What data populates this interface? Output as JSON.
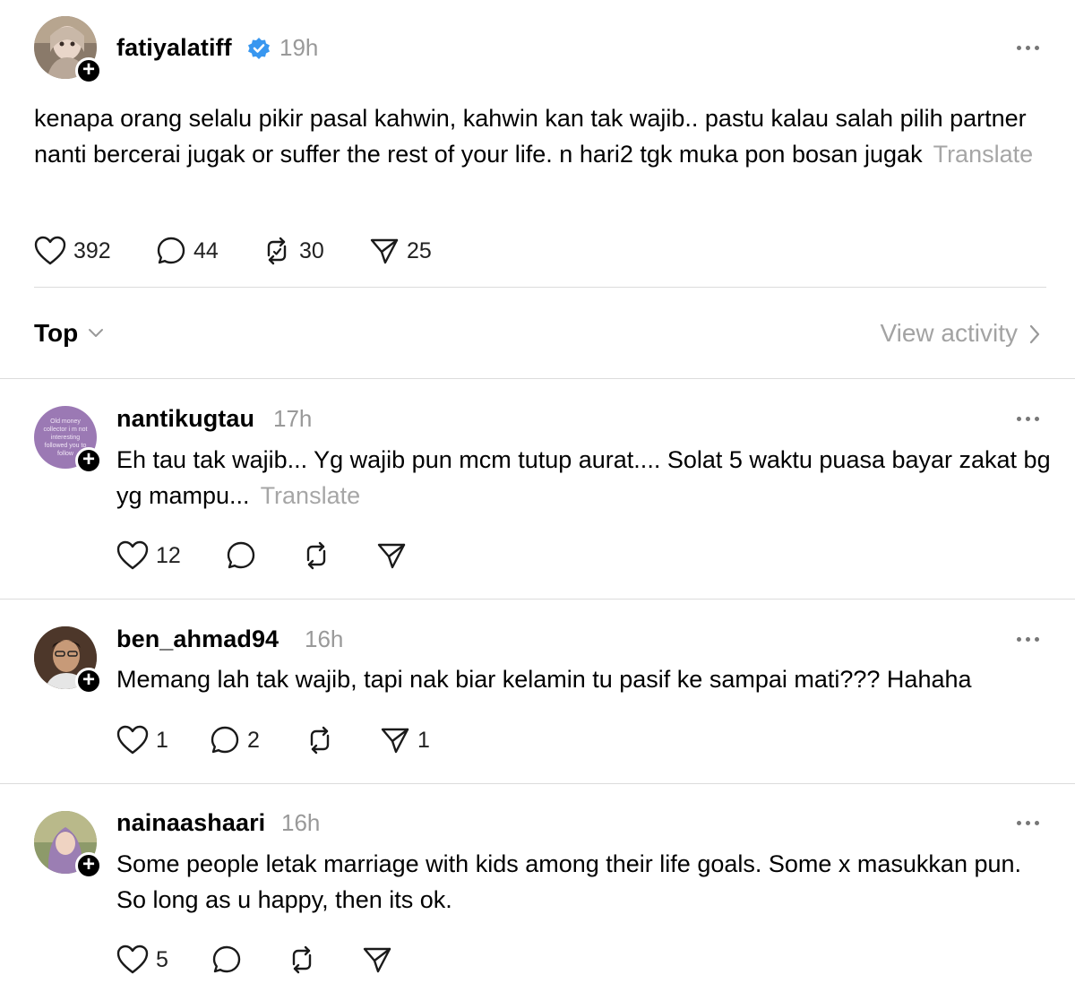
{
  "post": {
    "username": "fatiyalatiff",
    "time": "19h",
    "text": "kenapa orang selalu pikir pasal kahwin, kahwin kan tak wajib.. pastu kalau salah pilih partner nanti bercerai jugak or suffer the rest of your life. n hari2 tgk muka pon bosan jugak",
    "translate": "Translate",
    "likes": "392",
    "replies": "44",
    "reposts": "30",
    "shares": "25"
  },
  "sort": {
    "label": "Top",
    "view_activity": "View activity"
  },
  "replies": [
    {
      "username": "nantikugtau",
      "time": "17h",
      "avatar_text": "Old money collector i m not interesting followed you to follow",
      "text": "Eh tau tak wajib... Yg wajib pun mcm tutup aurat.... Solat 5 waktu puasa bayar zakat bg yg mampu...",
      "translate": "Translate",
      "likes": "12",
      "replies": "",
      "reposts": "",
      "shares": ""
    },
    {
      "username": "ben_ahmad94",
      "time": "16h",
      "text": "Memang lah tak wajib, tapi nak biar kelamin tu pasif ke sampai mati??? Hahaha",
      "likes": "1",
      "replies": "2",
      "reposts": "",
      "shares": "1"
    },
    {
      "username": "nainaashaari",
      "time": "16h",
      "text": "Some people letak marriage with kids among their life goals. Some x masukkan pun. So long as u happy, then its ok.",
      "likes": "5",
      "replies": "",
      "reposts": "",
      "shares": ""
    }
  ],
  "colors": {
    "text": "#000000",
    "muted": "#999999",
    "verified": "#3897f0",
    "divider": "#dcdcdc"
  },
  "icons": [
    "heart-icon",
    "comment-icon",
    "repost-icon",
    "share-icon",
    "verified-icon",
    "more-icon",
    "plus-icon",
    "chevron-down-icon",
    "chevron-right-icon"
  ]
}
